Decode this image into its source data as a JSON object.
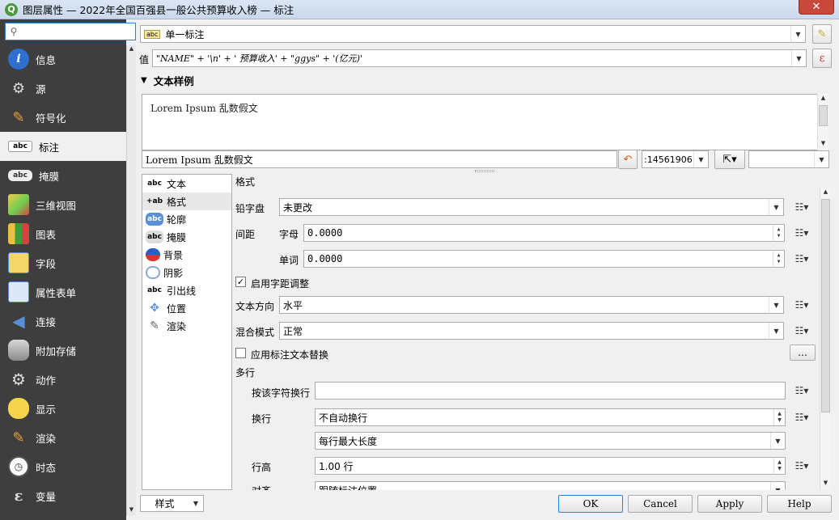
{
  "window": {
    "title": "图层属性 — 2022年全国百强县一般公共预算收入榜 — 标注",
    "close_glyph": "✕"
  },
  "search": {
    "placeholder": "",
    "value": ""
  },
  "sidebar": {
    "items": [
      {
        "label": "信息",
        "icon": "info-icon"
      },
      {
        "label": "源",
        "icon": "source-icon"
      },
      {
        "label": "符号化",
        "icon": "symbology-icon"
      },
      {
        "label": "标注",
        "icon": "labels-icon"
      },
      {
        "label": "掩膜",
        "icon": "mask-icon"
      },
      {
        "label": "三维视图",
        "icon": "3d-view-icon"
      },
      {
        "label": "图表",
        "icon": "diagram-icon"
      },
      {
        "label": "字段",
        "icon": "fields-icon"
      },
      {
        "label": "属性表单",
        "icon": "attributes-form-icon"
      },
      {
        "label": "连接",
        "icon": "joins-icon"
      },
      {
        "label": "附加存储",
        "icon": "auxiliary-storage-icon"
      },
      {
        "label": "动作",
        "icon": "actions-icon"
      },
      {
        "label": "显示",
        "icon": "display-icon"
      },
      {
        "label": "渲染",
        "icon": "rendering-icon"
      },
      {
        "label": "时态",
        "icon": "temporal-icon"
      },
      {
        "label": "变量",
        "icon": "variables-icon"
      }
    ],
    "active": "标注"
  },
  "label_mode": {
    "value": "单一标注",
    "badge": "abc"
  },
  "value_field": {
    "label": "值",
    "expression": "\"NAME\" + '\\n' + ' 预算收入' + \"ggys\" + '(亿元)'",
    "epsilon": "ε"
  },
  "text_sample": {
    "header": "文本样例",
    "preview": "Lorem Ipsum 乱数假文",
    "input": "Lorem Ipsum 乱数假文",
    "scale": ":14561906"
  },
  "subnav": {
    "items": [
      {
        "label": "文本",
        "badge": "abc"
      },
      {
        "label": "格式",
        "badge": "+ab"
      },
      {
        "label": "轮廓",
        "badge": "abc"
      },
      {
        "label": "掩膜",
        "badge": "abc"
      },
      {
        "label": "背景",
        "badge": ""
      },
      {
        "label": "阴影",
        "badge": ""
      },
      {
        "label": "引出线",
        "badge": "abc"
      },
      {
        "label": "位置",
        "badge": ""
      },
      {
        "label": "渲染",
        "badge": ""
      }
    ],
    "active": "格式"
  },
  "format": {
    "title": "格式",
    "typecase_label": "铅字盘",
    "typecase_value": "未更改",
    "spacing_label": "间距",
    "letter_label": "字母",
    "letter_value": "0.0000",
    "word_label": "单词",
    "word_value": "0.0000",
    "kerning_label": "启用字距调整",
    "kerning_checked": true,
    "direction_label": "文本方向",
    "direction_value": "水平",
    "blend_label": "混合模式",
    "blend_value": "正常",
    "substitution_label": "应用标注文本替换",
    "substitution_checked": false,
    "ellipsis": "…",
    "multiline_title": "多行",
    "wrap_char_label": "按该字符换行",
    "wrap_char_value": "",
    "wrap_label": "换行",
    "wrap_value": "不自动换行",
    "wrap_mode_value": "每行最大长度",
    "line_height_label": "行高",
    "line_height_value": "1.00 行",
    "align_label": "对齐",
    "align_value": "跟随标注位置"
  },
  "footer": {
    "style_label": "样式",
    "ok": "OK",
    "cancel": "Cancel",
    "apply": "Apply",
    "help": "Help"
  },
  "colors": {
    "sidebar_bg": "#3e3e3e",
    "accent": "#3a7bd5"
  }
}
